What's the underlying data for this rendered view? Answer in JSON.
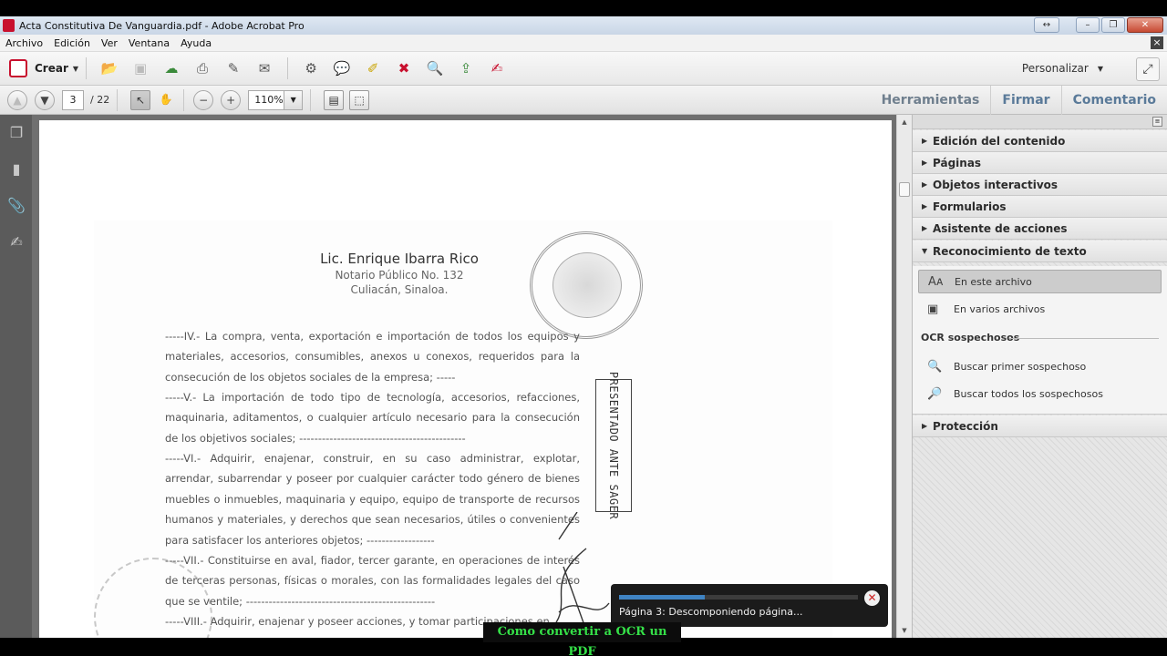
{
  "window": {
    "title": "Acta Constitutiva De Vanguardia.pdf - Adobe Acrobat Pro",
    "controls": [
      "↔",
      "–",
      "❐",
      "✕"
    ]
  },
  "menu": [
    "Archivo",
    "Edición",
    "Ver",
    "Ventana",
    "Ayuda"
  ],
  "toolbar": {
    "create_label": "Crear",
    "customize_label": "Personalizar"
  },
  "nav": {
    "current_page": "3",
    "total_pages": "/ 22",
    "zoom": "110%"
  },
  "panes": [
    "Herramientas",
    "Firmar",
    "Comentario"
  ],
  "document": {
    "letterhead": {
      "name": "Lic. Enrique Ibarra Rico",
      "line2": "Notario Público No. 132",
      "line3": "Culiacán, Sinaloa."
    },
    "paragraphs": [
      "-----IV.- La compra, venta, exportación e importación de todos los equipos y materiales, accesorios, consumibles, anexos u conexos, requeridos para la consecución de los objetos sociales de la empresa; -----",
      "-----V.- La importación de todo tipo de tecnología, accesorios, refacciones, maquinaria, aditamentos, o cualquier artículo necesario para la consecución de los objetivos sociales; --------------------------------------------",
      "-----VI.- Adquirir, enajenar, construir, en su caso administrar, explotar, arrendar, subarrendar y poseer por cualquier carácter todo género de bienes muebles o inmuebles, maquinaria y equipo, equipo de transporte de recursos humanos y materiales, y derechos que sean necesarios, útiles o convenientes para satisfacer los anteriores objetos; ------------------",
      "-----VII.- Constituirse en aval, fiador, tercer garante, en operaciones de interés de terceras personas, físicas o morales, con las formalidades legales del caso que se ventile; --------------------------------------------------",
      "-----VIII.- Adquirir, enajenar y poseer acciones, y tomar participaciones en"
    ],
    "stamp_text": "PRESENTADO ANTE SAGER"
  },
  "progress": {
    "fraction": 0.36,
    "message": "Página 3:  Descomponiendo página..."
  },
  "right_panel": {
    "sections_top": [
      "Edición del contenido",
      "Páginas",
      "Objetos interactivos",
      "Formularios",
      "Asistente de acciones"
    ],
    "open_section": "Reconocimiento de texto",
    "items": [
      "En este archivo",
      "En varios archivos"
    ],
    "subheading": "OCR sospechosos",
    "ocr_items": [
      "Buscar primer sospechoso",
      "Buscar todos los sospechosos"
    ],
    "bottom_section": "Protección"
  },
  "caption": "Como convertir a OCR un PDF",
  "colors": {
    "accent": "#3f83c2",
    "caption_text": "#35e048",
    "pane_text": "#5a7a99"
  }
}
